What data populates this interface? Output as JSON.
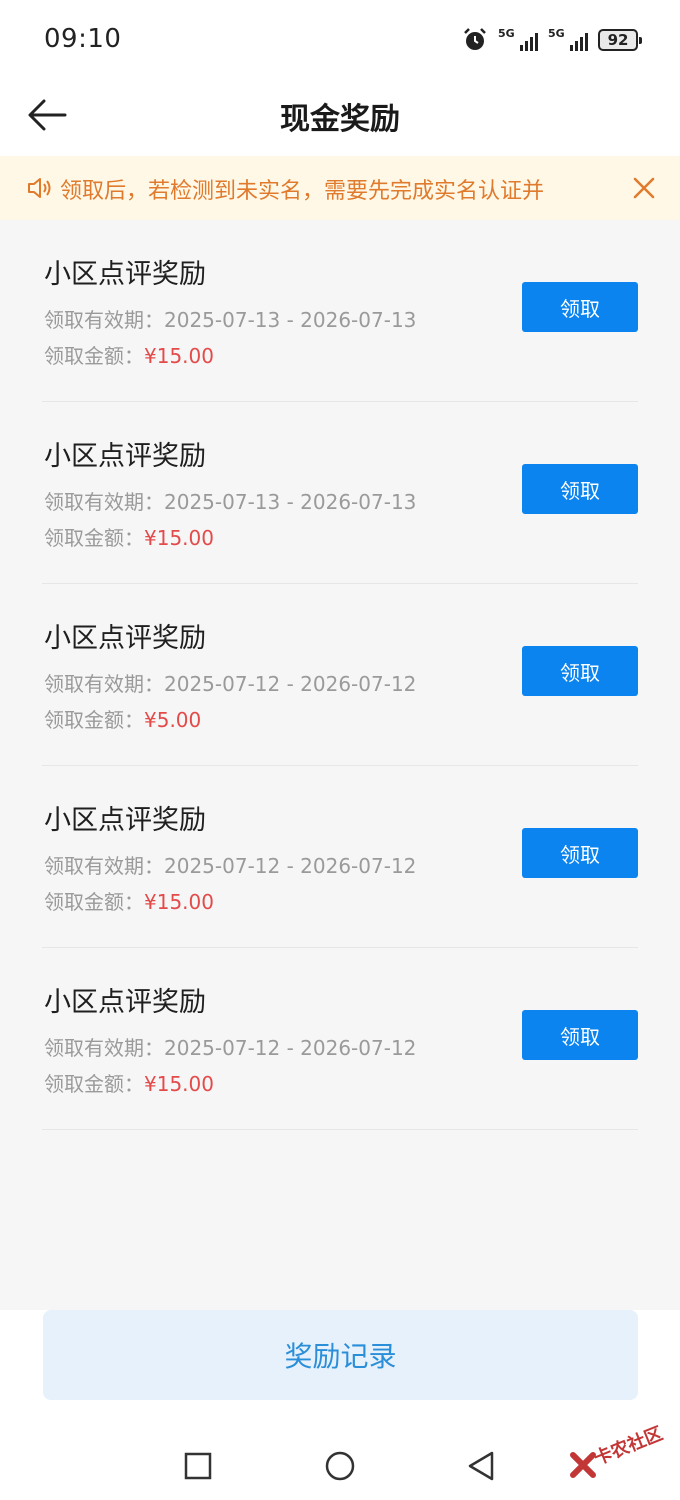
{
  "status_bar": {
    "time": "09:10",
    "network_1": "5G",
    "network_2": "5G",
    "battery": "92",
    "icons": [
      "alarm-icon",
      "signal-icon",
      "signal-icon",
      "battery-icon"
    ]
  },
  "header": {
    "title": "现金奖励",
    "back_icon": "arrow-left-icon"
  },
  "notice": {
    "text": "领取后，若检测到未实名，需要先完成实名认证并",
    "speaker_icon": "speaker-icon",
    "close_icon": "close-icon",
    "color": "#e07a2c"
  },
  "rewards": [
    {
      "title": "小区点评奖励",
      "validity_label": "领取有效期：",
      "validity": "2025-07-13 - 2026-07-13",
      "amount_label": "领取金额：",
      "amount": "¥15.00",
      "button": "领取"
    },
    {
      "title": "小区点评奖励",
      "validity_label": "领取有效期：",
      "validity": "2025-07-13 - 2026-07-13",
      "amount_label": "领取金额：",
      "amount": "¥15.00",
      "button": "领取"
    },
    {
      "title": "小区点评奖励",
      "validity_label": "领取有效期：",
      "validity": "2025-07-12 - 2026-07-12",
      "amount_label": "领取金额：",
      "amount": "¥5.00",
      "button": "领取"
    },
    {
      "title": "小区点评奖励",
      "validity_label": "领取有效期：",
      "validity": "2025-07-12 - 2026-07-12",
      "amount_label": "领取金额：",
      "amount": "¥15.00",
      "button": "领取"
    },
    {
      "title": "小区点评奖励",
      "validity_label": "领取有效期：",
      "validity": "2025-07-12 - 2026-07-12",
      "amount_label": "领取金额：",
      "amount": "¥15.00",
      "button": "领取"
    }
  ],
  "footer": {
    "records_button": "奖励记录"
  },
  "system_nav": {
    "icons": [
      "recents-square-icon",
      "home-circle-icon",
      "back-triangle-icon"
    ]
  },
  "watermark": {
    "text": "卡农社区"
  },
  "colors": {
    "accent": "#0b84f0",
    "amount": "#e34b4b",
    "records_bg": "#e6f1fc",
    "records_text": "#2b8ed8"
  }
}
